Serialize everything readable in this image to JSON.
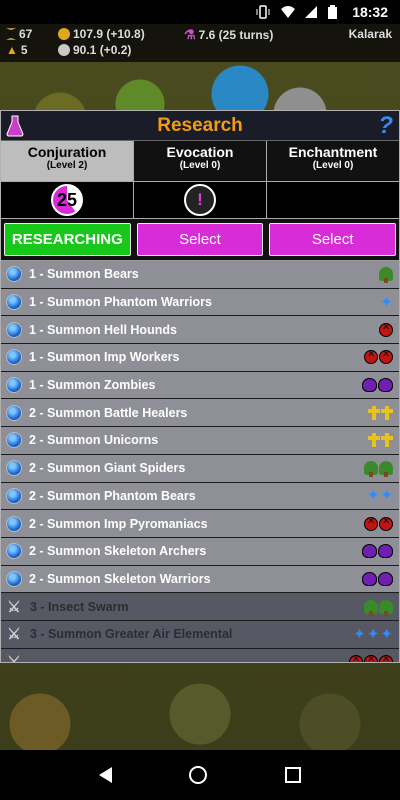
{
  "status_bar": {
    "time": "18:32",
    "icons": [
      "vibrate-icon",
      "wifi-icon",
      "signal-icon",
      "battery-icon"
    ]
  },
  "resources": {
    "turn": "67",
    "workers": "5",
    "gold": "107.9 (+10.8)",
    "silver": "90.1 (+0.2)",
    "mana": "7.6 (25 turns)",
    "player": "Kalarak"
  },
  "research": {
    "title": "Research",
    "help_label": "?",
    "tabs": [
      {
        "name": "Conjuration",
        "level": "(Level 2)",
        "active": true
      },
      {
        "name": "Evocation",
        "level": "(Level 0)",
        "active": false
      },
      {
        "name": "Enchantment",
        "level": "(Level 0)",
        "active": false
      }
    ],
    "progress": {
      "conjuration_turns": "25",
      "conjuration_fraction": 0.6,
      "evocation_mark": "!"
    },
    "buttons": {
      "conjuration": "RESEARCHING",
      "evocation": "Select",
      "enchantment": "Select"
    },
    "spells": [
      {
        "label": "1 - Summon Bears",
        "state": "available",
        "icons": [
          "tree-icon"
        ]
      },
      {
        "label": "1 - Summon Phantom Warriors",
        "state": "available",
        "icons": [
          "blue-star-icon"
        ]
      },
      {
        "label": "1 - Summon Hell Hounds",
        "state": "available",
        "icons": [
          "hell-icon"
        ]
      },
      {
        "label": "1 - Summon Imp Workers",
        "state": "available",
        "icons": [
          "hell-icon",
          "hell-icon"
        ]
      },
      {
        "label": "1 - Summon Zombies",
        "state": "available",
        "icons": [
          "skull-icon",
          "skull-icon"
        ]
      },
      {
        "label": "2 - Summon Battle Healers",
        "state": "available",
        "icons": [
          "cross-icon",
          "cross-icon"
        ]
      },
      {
        "label": "2 - Summon Unicorns",
        "state": "available",
        "icons": [
          "cross-icon",
          "cross-icon"
        ]
      },
      {
        "label": "2 - Summon Giant Spiders",
        "state": "available",
        "icons": [
          "tree-icon",
          "tree-icon"
        ]
      },
      {
        "label": "2 - Summon Phantom Bears",
        "state": "available",
        "icons": [
          "blue-star-icon",
          "blue-star-icon"
        ]
      },
      {
        "label": "2 - Summon Imp Pyromaniacs",
        "state": "available",
        "icons": [
          "hell-icon",
          "hell-icon"
        ]
      },
      {
        "label": "2 - Summon Skeleton Archers",
        "state": "available",
        "icons": [
          "skull-icon",
          "skull-icon"
        ]
      },
      {
        "label": "2 - Summon Skeleton Warriors",
        "state": "available",
        "icons": [
          "skull-icon",
          "skull-icon"
        ]
      },
      {
        "label": "3 - Insect Swarm",
        "state": "locked",
        "icons": [
          "tree-icon",
          "tree-icon"
        ]
      },
      {
        "label": "3 - Summon Greater Air Elemental",
        "state": "locked",
        "icons": [
          "blue-star-icon",
          "blue-star-icon",
          "blue-star-icon"
        ]
      },
      {
        "label": "",
        "state": "locked",
        "icons": [
          "hell-icon",
          "hell-icon",
          "hell-icon"
        ]
      }
    ]
  },
  "colors": {
    "title": "#f39b12",
    "researching": "#17c81a",
    "select": "#d72cd7",
    "active_tab": "#bdbdbd"
  }
}
